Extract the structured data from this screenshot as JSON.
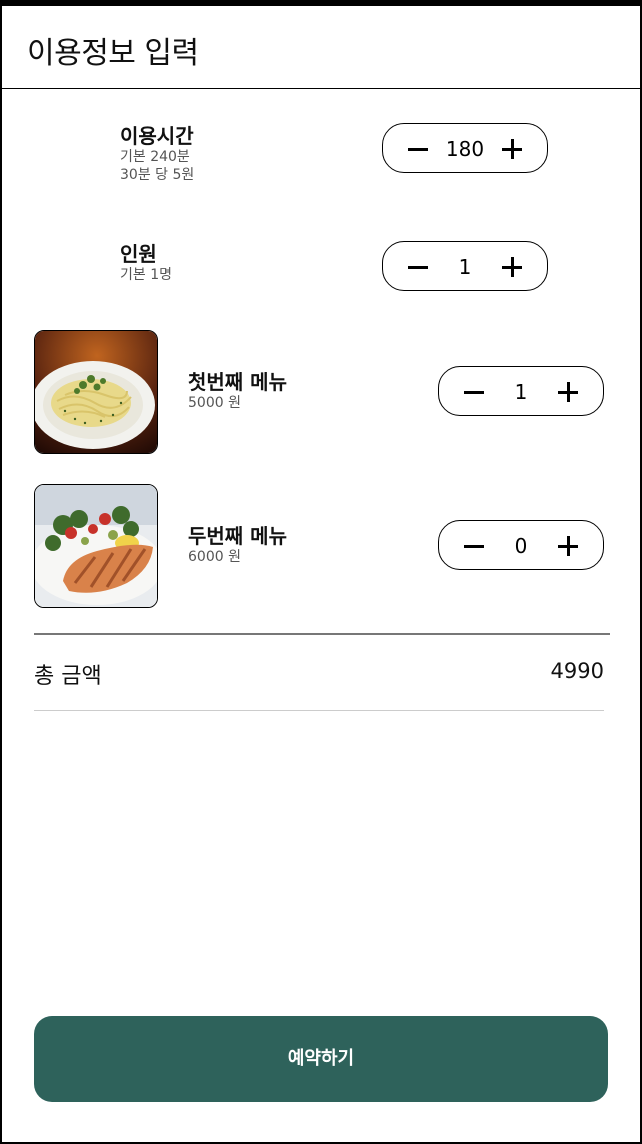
{
  "header": {
    "title": "이용정보 입력"
  },
  "usage_time": {
    "label": "이용시간",
    "sub1": "기본 240분",
    "sub2": "30분 당 5원",
    "value": "180"
  },
  "people": {
    "label": "인원",
    "sub1": "기본 1명",
    "value": "1"
  },
  "menus": [
    {
      "name": "첫번째 메뉴",
      "price": "5000 원",
      "quantity": "1"
    },
    {
      "name": "두번째 메뉴",
      "price": "6000 원",
      "quantity": "0"
    }
  ],
  "total": {
    "label": "총 금액",
    "value": "4990"
  },
  "reserve_button": {
    "label": "예약하기"
  },
  "colors": {
    "accent": "#2e625b"
  },
  "icons": {
    "decrement": "minus-icon",
    "increment": "plus-icon"
  }
}
